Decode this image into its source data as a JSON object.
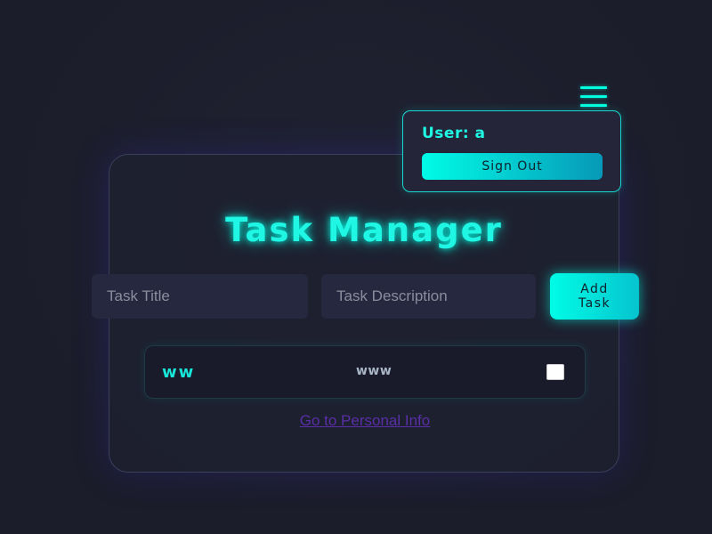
{
  "header": {
    "menu_icon": "hamburger-icon",
    "user_label": "User: a",
    "sign_out_label": "Sign Out"
  },
  "main": {
    "title": "Task Manager",
    "task_title_placeholder": "Task Title",
    "task_description_placeholder": "Task Description",
    "add_task_label": "Add Task",
    "tasks": [
      {
        "title": "ww",
        "description": "www",
        "completed": false
      }
    ],
    "personal_info_link": "Go to Personal Info"
  },
  "colors": {
    "accent": "#1ff7e4",
    "background": "#1c1e2b",
    "link": "#5a2ea6"
  }
}
